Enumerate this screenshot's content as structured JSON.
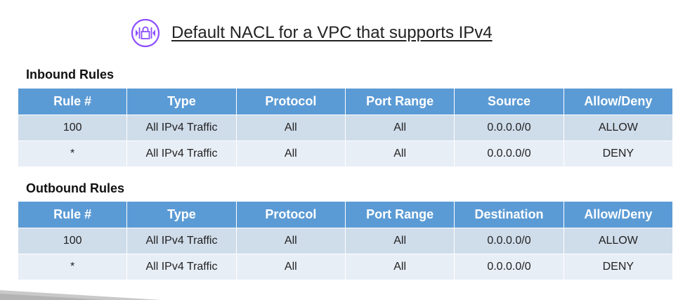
{
  "title": "Default NACL for a VPC that supports IPv4",
  "icon": "network-acl-icon",
  "colors": {
    "header_bg": "#5b9bd5",
    "row_odd_bg": "#cfdcea",
    "row_even_bg": "#e8eef6",
    "icon_purple": "#8c4fff",
    "allow": "#22a84a",
    "deny": "#e0191f"
  },
  "inbound": {
    "label": "Inbound Rules",
    "headers": [
      "Rule #",
      "Type",
      "Protocol",
      "Port Range",
      "Source",
      "Allow/Deny"
    ],
    "rows": [
      [
        "100",
        "All IPv4 Traffic",
        "All",
        "All",
        "0.0.0.0/0",
        "ALLOW"
      ],
      [
        "*",
        "All IPv4 Traffic",
        "All",
        "All",
        "0.0.0.0/0",
        "DENY"
      ]
    ]
  },
  "outbound": {
    "label": "Outbound Rules",
    "headers": [
      "Rule #",
      "Type",
      "Protocol",
      "Port Range",
      "Destination",
      "Allow/Deny"
    ],
    "rows": [
      [
        "100",
        "All IPv4 Traffic",
        "All",
        "All",
        "0.0.0.0/0",
        "ALLOW"
      ],
      [
        "*",
        "All IPv4 Traffic",
        "All",
        "All",
        "0.0.0.0/0",
        "DENY"
      ]
    ]
  }
}
